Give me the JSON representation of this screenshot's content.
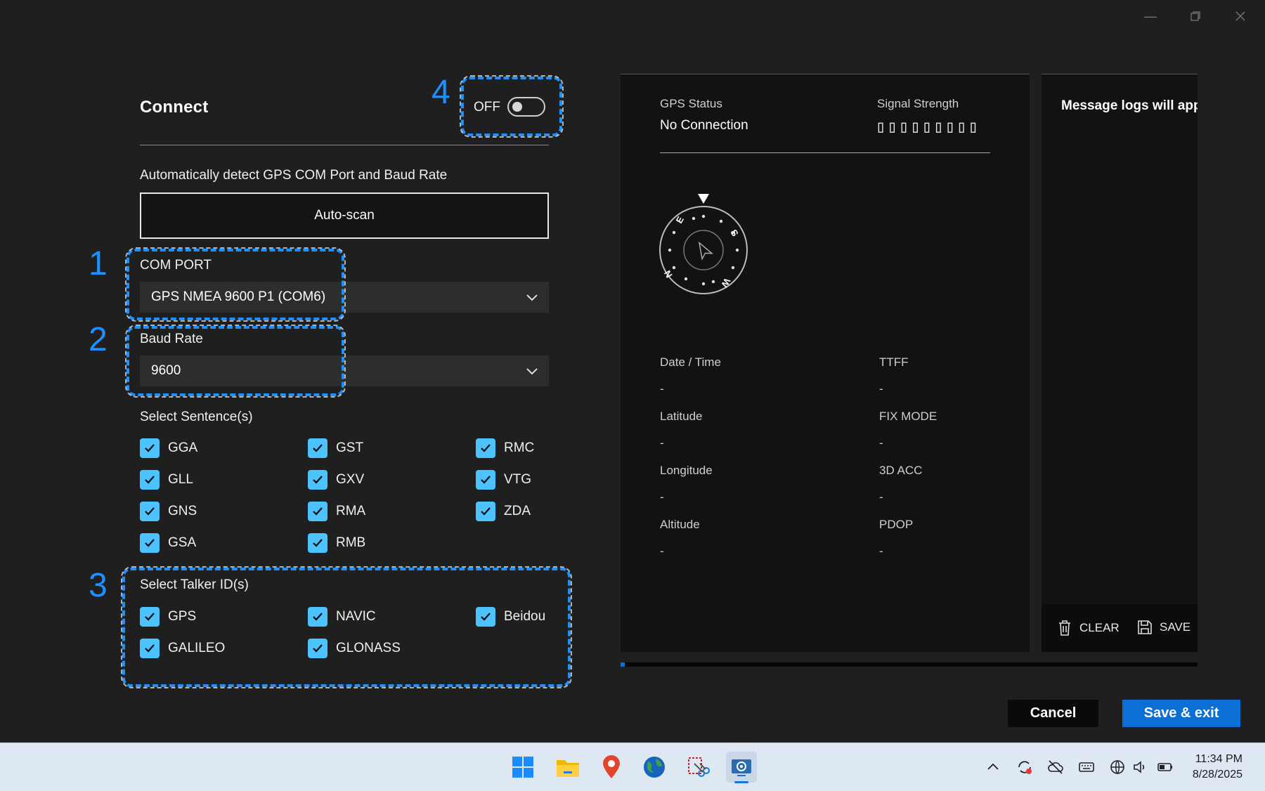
{
  "window": {
    "minimize_icon": "minimize-icon",
    "restore_icon": "restore-icon",
    "close_icon": "close-icon"
  },
  "connect": {
    "title": "Connect",
    "toggle_label": "OFF",
    "toggle_state": "off",
    "autodetect_text": "Automatically detect GPS COM Port and Baud Rate",
    "autoscan_label": "Auto-scan",
    "com_port_label": "COM PORT",
    "com_port_value": "GPS NMEA 9600 P1 (COM6)",
    "baud_label": "Baud Rate",
    "baud_value": "9600",
    "sentences_label": "Select Sentence(s)",
    "sentences": [
      {
        "label": "GGA",
        "checked": true
      },
      {
        "label": "GST",
        "checked": true
      },
      {
        "label": "RMC",
        "checked": true
      },
      {
        "label": "GLL",
        "checked": true
      },
      {
        "label": "GXV",
        "checked": true
      },
      {
        "label": "VTG",
        "checked": true
      },
      {
        "label": "GNS",
        "checked": true
      },
      {
        "label": "RMA",
        "checked": true
      },
      {
        "label": "ZDA",
        "checked": true
      },
      {
        "label": "GSA",
        "checked": true
      },
      {
        "label": "RMB",
        "checked": true
      }
    ],
    "talkers_label": "Select Talker ID(s)",
    "talkers": [
      {
        "label": "GPS",
        "checked": true
      },
      {
        "label": "NAVIC",
        "checked": true
      },
      {
        "label": "Beidou",
        "checked": true
      },
      {
        "label": "GALILEO",
        "checked": true
      },
      {
        "label": "GLONASS",
        "checked": true
      }
    ]
  },
  "callouts": {
    "n1": "1",
    "n2": "2",
    "n3": "3",
    "n4": "4",
    "color": "#1e90ff"
  },
  "gps": {
    "status_label": "GPS Status",
    "status_value": "No Connection",
    "signal_label": "Signal Strength",
    "signal_bars": "▯▯▯▯▯▯▯▯▯",
    "compass": {
      "n": "N",
      "e": "E",
      "s": "S",
      "w": "W"
    },
    "fields": {
      "datetime_label": "Date / Time",
      "datetime_value": "-",
      "ttff_label": "TTFF",
      "ttff_value": "-",
      "lat_label": "Latitude",
      "lat_value": "-",
      "fix_label": "FIX MODE",
      "fix_value": "-",
      "lon_label": "Longitude",
      "lon_value": "-",
      "acc_label": "3D ACC",
      "acc_value": "-",
      "alt_label": "Altitude",
      "alt_value": "-",
      "pdop_label": "PDOP",
      "pdop_value": "-"
    }
  },
  "log": {
    "placeholder": "Message logs will app",
    "clear_label": "CLEAR",
    "save_label": "SAVE"
  },
  "footer": {
    "cancel_label": "Cancel",
    "save_exit_label": "Save & exit",
    "accent": "#0b6fd6"
  },
  "taskbar": {
    "apps": [
      "windows-start-icon",
      "file-explorer-icon",
      "maps-icon",
      "globe-browser-icon",
      "snipping-tool-icon",
      "gps-settings-app-icon"
    ],
    "time": "11:34 PM",
    "date": "8/28/2025"
  }
}
